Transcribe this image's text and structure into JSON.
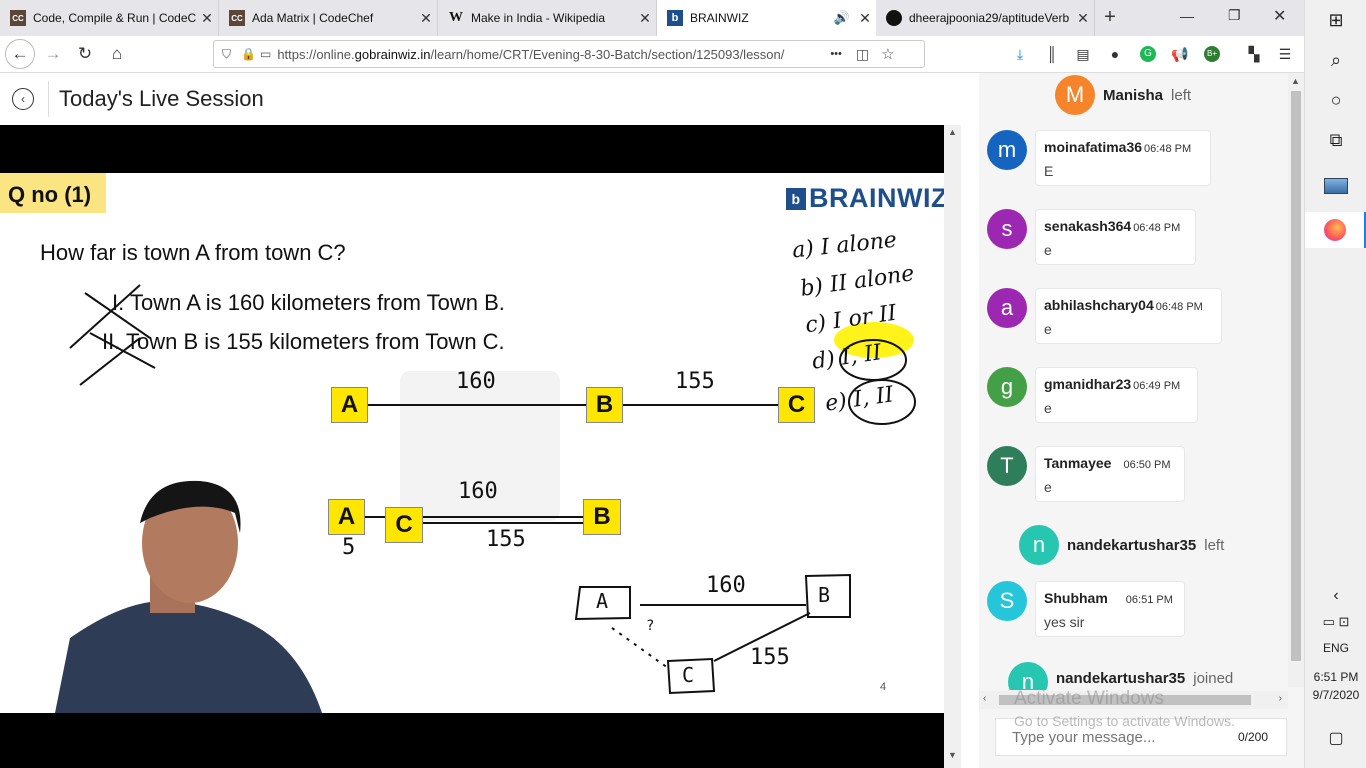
{
  "browser": {
    "tabs": [
      {
        "label": "Code, Compile & Run | CodeChef",
        "favicon": "CC",
        "favicon_color": "#5b4638",
        "active": false
      },
      {
        "label": "Ada Matrix | CodeChef",
        "favicon": "CC",
        "favicon_color": "#5b4638",
        "active": false
      },
      {
        "label": "Make in India - Wikipedia",
        "favicon": "W",
        "favicon_color": "#ffffff",
        "active": false
      },
      {
        "label": "BRAINWIZ",
        "favicon": "b",
        "favicon_color": "#1e4e8c",
        "active": true
      },
      {
        "label": "dheerajpoonia29/aptitudeVerb",
        "favicon": "gh",
        "favicon_color": "#111111",
        "active": false
      }
    ],
    "new_tab": "+",
    "url_prefix": "https://online.",
    "url_domain": "gobrainwiz.in",
    "url_path": "/learn/home/CRT/Evening-8-30-Batch/section/125093/lesson/",
    "more": "•••"
  },
  "page": {
    "title": "Today's Live Session"
  },
  "slide": {
    "qno": "Q no (1)",
    "brand": "BRAINWIZ",
    "question": "How far is town A from town C?",
    "statement1": "I. Town A is 160 kilometers from Town B.",
    "statement2": "II. Town B is 155 kilometers from Town C.",
    "box_a": "A",
    "box_b": "B",
    "box_c": "C",
    "slide_number": "4",
    "handwriting": {
      "opt_a": "a) I alone",
      "opt_b": "b) II alone",
      "opt_c": "c) I or II",
      "opt_d": "d) I, II",
      "opt_e": "e) I, II",
      "d160": "160",
      "d155": "155",
      "d5": "5",
      "q": "?"
    },
    "highlight_color": "#fff200"
  },
  "chat": {
    "messages": [
      {
        "type": "system",
        "user": "Manisha",
        "action": "left",
        "initial": "M",
        "color": "#f5842a"
      },
      {
        "type": "msg",
        "user": "moinafatima36",
        "time": "06:48 PM",
        "text": "E",
        "initial": "m",
        "color": "#1565c0"
      },
      {
        "type": "msg",
        "user": "senakash364",
        "time": "06:48 PM",
        "text": "e",
        "initial": "s",
        "color": "#9c27b0"
      },
      {
        "type": "msg",
        "user": "abhilashchary04",
        "time": "06:48 PM",
        "text": "e",
        "initial": "a",
        "color": "#9c27b0"
      },
      {
        "type": "msg",
        "user": "gmanidhar23",
        "time": "06:49 PM",
        "text": "e",
        "initial": "g",
        "color": "#43a047"
      },
      {
        "type": "msg",
        "user": "Tanmayee",
        "time": "06:50 PM",
        "text": "e",
        "initial": "T",
        "color": "#2e7d5b"
      },
      {
        "type": "system",
        "user": "nandekartushar35",
        "action": "left",
        "initial": "n",
        "color": "#26c6b0"
      },
      {
        "type": "msg",
        "user": "Shubham",
        "time": "06:51 PM",
        "text": "yes sir",
        "initial": "S",
        "color": "#26c6da"
      },
      {
        "type": "system",
        "user": "nandekartushar35",
        "action": "joined",
        "initial": "n",
        "color": "#26c6b0"
      }
    ],
    "placeholder": "Type your message...",
    "counter": "0/200"
  },
  "watermark": {
    "line1": "Activate Windows",
    "line2": "Go to Settings to activate Windows."
  },
  "taskbar": {
    "lang": "ENG",
    "time": "6:51 PM",
    "date": "9/7/2020"
  }
}
